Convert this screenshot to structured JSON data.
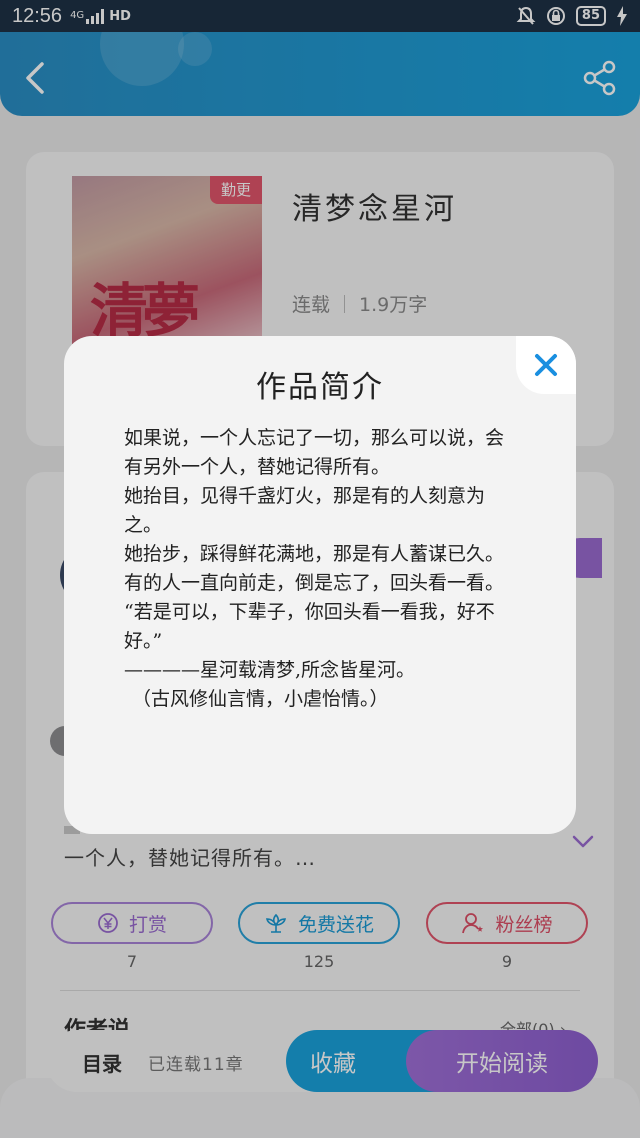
{
  "status_bar": {
    "time": "12:56",
    "network": "4G",
    "hd": "HD",
    "battery": "85"
  },
  "book": {
    "cover_text": "清夢",
    "badge": "勤更",
    "title": "清梦念星河",
    "status": "连载",
    "word_count": "1.9万字"
  },
  "description_preview_tail": "一个人，替她记得所有。…",
  "actions": [
    {
      "label": "打赏",
      "count": "7",
      "icon": "yen-coin-icon"
    },
    {
      "label": "免费送花",
      "count": "125",
      "icon": "flower-icon"
    },
    {
      "label": "粉丝榜",
      "count": "9",
      "icon": "fans-user-icon"
    }
  ],
  "author_section": {
    "title": "作者说",
    "all_link": "全部(0) ›"
  },
  "bottom_bar": {
    "catalog": "目录",
    "chapters": "已连载11章",
    "collect": "收藏",
    "start_reading": "开始阅读"
  },
  "modal": {
    "title": "作品简介",
    "lines": [
      "如果说，一个人忘记了一切，那么可以说，会有另外一个人，替她记得所有。",
      "她抬目，见得千盏灯火，那是有的人刻意为之。",
      "她抬步，踩得鲜花满地，那是有人蓄谋已久。",
      "有的人一直向前走，倒是忘了，回头看一看。",
      "“若是可以，下辈子，你回头看一看我，好不好。”",
      "————星河载清梦,所念皆星河。",
      "（古风修仙言情，小虐怡情。）"
    ]
  },
  "colors": {
    "header_blue": "#1aa2dc",
    "accent_purple": "#9a6bd0",
    "accent_red": "#e0556b",
    "close_blue": "#1a8fe0"
  }
}
